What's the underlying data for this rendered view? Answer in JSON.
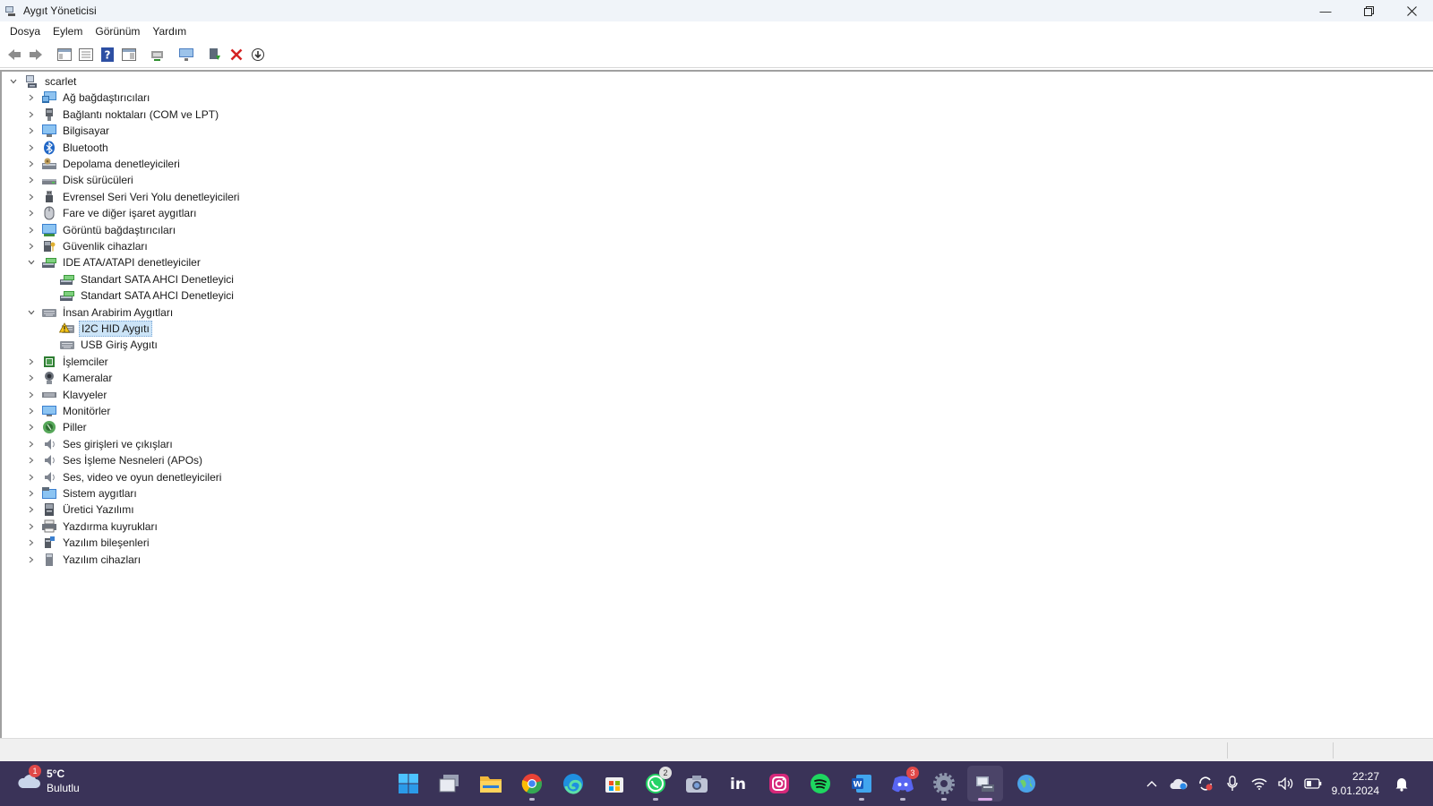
{
  "window": {
    "title": "Aygıt Yöneticisi",
    "minimize_icon": "minimize-icon",
    "maximize_icon": "restore-icon",
    "close_icon": "close-icon"
  },
  "menu": [
    "Dosya",
    "Eylem",
    "Görünüm",
    "Yardım"
  ],
  "toolbar_icons": [
    "back-arrow-icon",
    "forward-arrow-icon",
    "show-hide-tree-icon",
    "properties-icon",
    "help-icon",
    "action-pane-icon",
    "update-driver-icon",
    "monitor-scan-icon",
    "enable-device-icon",
    "uninstall-icon",
    "download-icon"
  ],
  "tree": {
    "root": "scarlet",
    "items": [
      {
        "label": "Ağ bağdaştırıcıları",
        "icon": "network-adapter-icon",
        "expanded": false,
        "children": []
      },
      {
        "label": "Bağlantı noktaları (COM ve LPT)",
        "icon": "port-icon",
        "expanded": false,
        "children": []
      },
      {
        "label": "Bilgisayar",
        "icon": "computer-icon",
        "expanded": false,
        "children": []
      },
      {
        "label": "Bluetooth",
        "icon": "bluetooth-icon",
        "expanded": false,
        "children": []
      },
      {
        "label": "Depolama denetleyicileri",
        "icon": "storage-controller-icon",
        "expanded": false,
        "children": []
      },
      {
        "label": "Disk sürücüleri",
        "icon": "disk-drive-icon",
        "expanded": false,
        "children": []
      },
      {
        "label": "Evrensel Seri Veri Yolu denetleyicileri",
        "icon": "usb-icon",
        "expanded": false,
        "children": []
      },
      {
        "label": "Fare ve diğer işaret aygıtları",
        "icon": "mouse-icon",
        "expanded": false,
        "children": []
      },
      {
        "label": "Görüntü bağdaştırıcıları",
        "icon": "display-adapter-icon",
        "expanded": false,
        "children": []
      },
      {
        "label": "Güvenlik cihazları",
        "icon": "security-device-icon",
        "expanded": false,
        "children": []
      },
      {
        "label": "IDE ATA/ATAPI denetleyiciler",
        "icon": "ide-controller-icon",
        "expanded": true,
        "children": [
          {
            "label": "Standart SATA AHCI Denetleyici",
            "icon": "ide-controller-icon",
            "selected": false
          },
          {
            "label": "Standart SATA AHCI Denetleyici",
            "icon": "ide-controller-icon",
            "selected": false
          }
        ]
      },
      {
        "label": "İnsan Arabirim Aygıtları",
        "icon": "hid-icon",
        "expanded": true,
        "children": [
          {
            "label": "I2C HID Aygıtı",
            "icon": "hid-warning-icon",
            "selected": true
          },
          {
            "label": "USB Giriş Aygıtı",
            "icon": "hid-icon",
            "selected": false
          }
        ]
      },
      {
        "label": "İşlemciler",
        "icon": "processor-icon",
        "expanded": false,
        "children": []
      },
      {
        "label": "Kameralar",
        "icon": "camera-icon",
        "expanded": false,
        "children": []
      },
      {
        "label": "Klavyeler",
        "icon": "keyboard-icon",
        "expanded": false,
        "children": []
      },
      {
        "label": "Monitörler",
        "icon": "monitor-icon",
        "expanded": false,
        "children": []
      },
      {
        "label": "Piller",
        "icon": "battery-icon",
        "expanded": false,
        "children": []
      },
      {
        "label": "Ses girişleri ve çıkışları",
        "icon": "audio-icon",
        "expanded": false,
        "children": []
      },
      {
        "label": "Ses İşleme Nesneleri (APOs)",
        "icon": "audio-icon",
        "expanded": false,
        "children": []
      },
      {
        "label": "Ses, video ve oyun denetleyicileri",
        "icon": "audio-icon",
        "expanded": false,
        "children": []
      },
      {
        "label": "Sistem aygıtları",
        "icon": "system-devices-icon",
        "expanded": false,
        "children": []
      },
      {
        "label": "Üretici Yazılımı",
        "icon": "firmware-icon",
        "expanded": false,
        "children": []
      },
      {
        "label": "Yazdırma kuyrukları",
        "icon": "printer-icon",
        "expanded": false,
        "children": []
      },
      {
        "label": "Yazılım bileşenleri",
        "icon": "software-component-icon",
        "expanded": false,
        "children": []
      },
      {
        "label": "Yazılım cihazları",
        "icon": "software-device-icon",
        "expanded": false,
        "children": []
      }
    ]
  },
  "taskbar": {
    "weather": {
      "temp": "5°C",
      "condition": "Bulutlu",
      "badge": "1"
    },
    "apps": [
      {
        "name": "start-icon",
        "badge": ""
      },
      {
        "name": "task-view-icon",
        "badge": ""
      },
      {
        "name": "file-explorer-icon",
        "badge": ""
      },
      {
        "name": "chrome-icon",
        "badge": ""
      },
      {
        "name": "edge-icon",
        "badge": ""
      },
      {
        "name": "store-icon",
        "badge": ""
      },
      {
        "name": "whatsapp-icon",
        "badge": "2"
      },
      {
        "name": "camera-app-icon",
        "badge": ""
      },
      {
        "name": "linkedin-icon",
        "badge": ""
      },
      {
        "name": "instagram-icon",
        "badge": ""
      },
      {
        "name": "spotify-icon",
        "badge": ""
      },
      {
        "name": "word-icon",
        "badge": ""
      },
      {
        "name": "discord-icon",
        "badge": "3"
      },
      {
        "name": "settings-icon",
        "badge": ""
      },
      {
        "name": "device-manager-icon",
        "badge": ""
      },
      {
        "name": "globe-app-icon",
        "badge": ""
      }
    ],
    "tray_icons": [
      "chevron-up-icon",
      "onedrive-icon",
      "sync-icon",
      "microphone-icon",
      "wifi-icon",
      "volume-icon",
      "battery-tray-icon"
    ],
    "time": "22:27",
    "date": "9.01.2024",
    "notification_icon": "notification-bell-icon"
  },
  "colors": {
    "selection": "#cce4f7",
    "taskbar": "#3a3358",
    "titlebar": "#f0f4f9"
  }
}
